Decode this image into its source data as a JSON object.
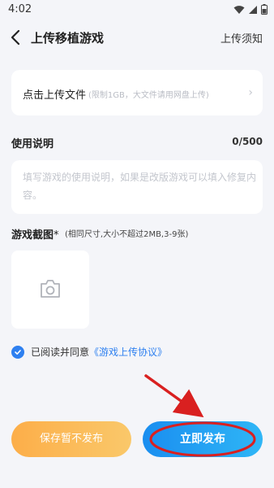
{
  "status": {
    "time": "4:02"
  },
  "nav": {
    "title": "上传移植游戏",
    "right_link": "上传须知"
  },
  "upload": {
    "label": "点击上传文件",
    "hint": "(限制1GB，大文件请用网盘上传)"
  },
  "description": {
    "label": "使用说明",
    "counter": "0/500",
    "placeholder": "填写游戏的使用说明，如果是改版游戏可以填入修复内容。"
  },
  "screenshots": {
    "label": "游戏截图",
    "required_mark": "*",
    "hint": "(相同尺寸,大小不超过2MB,3-9张)"
  },
  "agreement": {
    "text": "已阅读并同意",
    "link": "《游戏上传协议》",
    "checked": true
  },
  "actions": {
    "save_draft": "保存暂不发布",
    "publish": "立即发布"
  },
  "colors": {
    "accent": "#2e80f0",
    "save_gradient": "#fcae49",
    "publish_gradient": "#1a8ef0",
    "annotation_red": "#e52828"
  }
}
